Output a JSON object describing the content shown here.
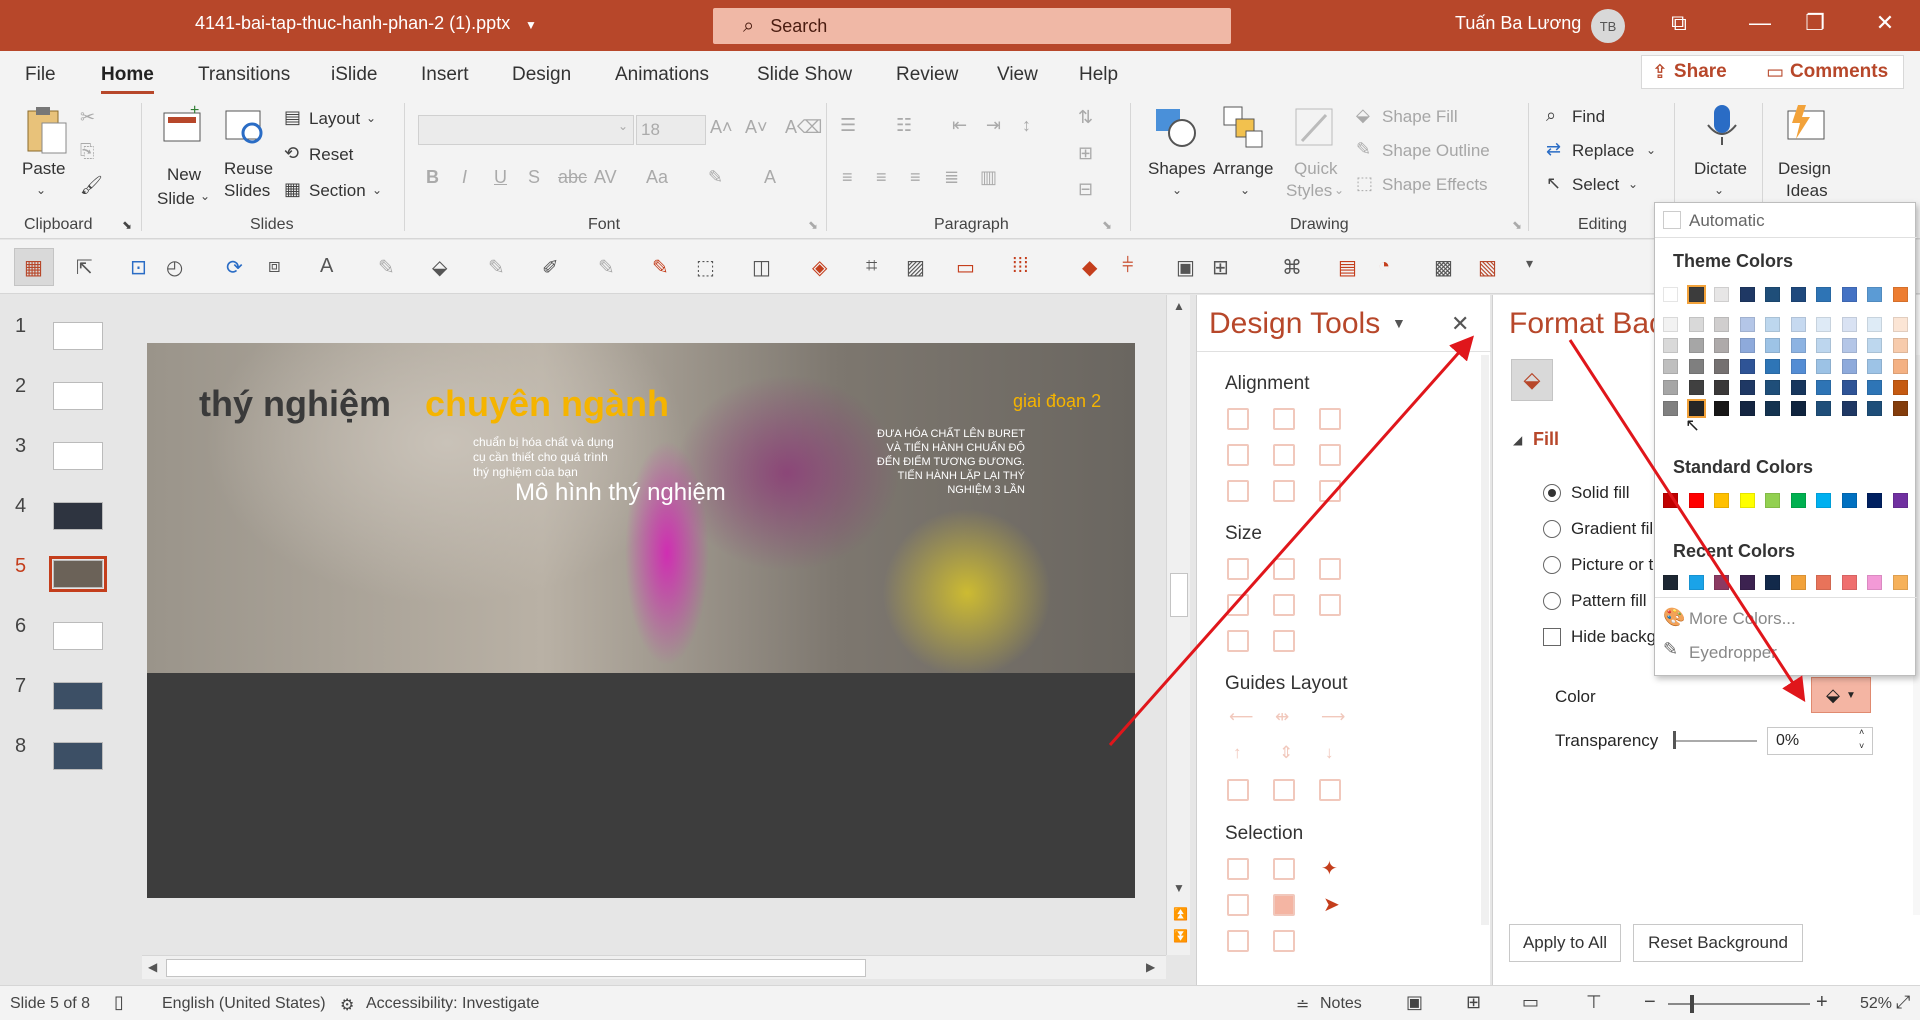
{
  "titlebar": {
    "filename": "4141-bai-tap-thuc-hanh-phan-2 (1).pptx",
    "search_placeholder": "Search",
    "user_name": "Tuấn Ba Lương",
    "user_initials": "TB"
  },
  "tabs": [
    "File",
    "Home",
    "Transitions",
    "iSlide",
    "Insert",
    "Design",
    "Animations",
    "Slide Show",
    "Review",
    "View",
    "Help"
  ],
  "share_label": "Share",
  "comments_label": "Comments",
  "ribbon": {
    "clipboard": {
      "paste": "Paste",
      "group": "Clipboard"
    },
    "slides": {
      "new_slide_1": "New",
      "new_slide_2": "Slide",
      "reuse_1": "Reuse",
      "reuse_2": "Slides",
      "layout": "Layout",
      "reset": "Reset",
      "section": "Section",
      "group": "Slides"
    },
    "font": {
      "size": "18",
      "group": "Font"
    },
    "paragraph": {
      "group": "Paragraph"
    },
    "drawing": {
      "shapes": "Shapes",
      "arrange": "Arrange",
      "quick_1": "Quick",
      "quick_2": "Styles",
      "shape_fill": "Shape Fill",
      "shape_outline": "Shape Outline",
      "shape_effects": "Shape Effects",
      "group": "Drawing"
    },
    "editing": {
      "find": "Find",
      "replace": "Replace",
      "select": "Select",
      "group": "Editing"
    },
    "voice": {
      "dictate": "Dictate"
    },
    "designer": {
      "ideas_1": "Design",
      "ideas_2": "Ideas"
    }
  },
  "thumbnails": [
    "1",
    "2",
    "3",
    "4",
    "5",
    "6",
    "7",
    "8"
  ],
  "slide": {
    "title_part1": "thý nghiệm",
    "title_part2": "chuyên ngành",
    "subtitle_1": "chuẩn bị hóa chất và dụng",
    "subtitle_2": "cụ cần thiết cho quá trình",
    "subtitle_3": "thý nghiệm của bạn",
    "model_label": "Mô hình thý nghiệm",
    "stage": "giai đoạn 2",
    "right_1": "ĐƯA HÓA CHẤT LÊN BURET",
    "right_2": "VÀ TIẾN HÀNH CHUẨN ĐỘ",
    "right_3": "ĐẾN ĐIỂM TƯƠNG ĐƯƠNG.",
    "right_4": "TIẾN HÀNH LẶP LẠI THÝ",
    "right_5": "NGHIỆM 3 LẦN"
  },
  "design_pane": {
    "title": "Design Tools",
    "sections": [
      "Alignment",
      "Size",
      "Guides Layout",
      "Selection"
    ]
  },
  "format_pane": {
    "title": "Format Background",
    "fill_label": "Fill",
    "options": [
      "Solid fill",
      "Gradient fill",
      "Picture or texture fill",
      "Pattern fill"
    ],
    "hide_label": "Hide background graphics",
    "color_label": "Color",
    "transparency_label": "Transparency",
    "transparency_value": "0%",
    "apply_all": "Apply to All",
    "reset_bg": "Reset Background"
  },
  "color_menu": {
    "automatic": "Automatic",
    "theme_title": "Theme Colors",
    "standard_title": "Standard Colors",
    "recent_title": "Recent Colors",
    "more": "More Colors...",
    "eyedropper": "Eyedropper",
    "theme_top": [
      "#ffffff",
      "#3c3c3c",
      "#e7e6e6",
      "#1f3864",
      "#1f4e79",
      "#1f497d",
      "#2e74b5",
      "#4472c4",
      "#5b9bd5",
      "#ed7d31"
    ],
    "theme_columns": [
      [
        "#f2f2f2",
        "#d9d9d9",
        "#bfbfbf",
        "#a6a6a6",
        "#808080"
      ],
      [
        "#d9d9d9",
        "#a6a6a6",
        "#7f7f7f",
        "#404040",
        "#262626"
      ],
      [
        "#d0cece",
        "#aeaaaa",
        "#757171",
        "#3a3838",
        "#171616"
      ],
      [
        "#b4c6e7",
        "#8eaadb",
        "#2f5496",
        "#1f3864",
        "#142541"
      ],
      [
        "#bdd7ee",
        "#9dc3e6",
        "#2e75b6",
        "#1f4e79",
        "#143350"
      ],
      [
        "#c6d9f0",
        "#8db3e2",
        "#548dd4",
        "#17365d",
        "#0f243e"
      ],
      [
        "#deeaf6",
        "#bdd6ee",
        "#9cc2e5",
        "#2e74b5",
        "#1f4e79"
      ],
      [
        "#d9e2f3",
        "#b4c6e7",
        "#8eaadb",
        "#2f5496",
        "#1f3864"
      ],
      [
        "#deebf6",
        "#bdd7ee",
        "#9dc3e6",
        "#2e75b6",
        "#1e4e79"
      ],
      [
        "#fbe5d5",
        "#f7cbac",
        "#f4b183",
        "#c55a11",
        "#833c0b"
      ]
    ],
    "standard": [
      "#c00000",
      "#ff0000",
      "#ffc000",
      "#ffff00",
      "#92d050",
      "#00b050",
      "#00b0f0",
      "#0070c0",
      "#002060",
      "#7030a0"
    ],
    "recent": [
      "#1d2733",
      "#1aa3e8",
      "#8b3a62",
      "#3c2250",
      "#12294a",
      "#f2a23a",
      "#e8735a",
      "#ef6f6f",
      "#f39ad7",
      "#f6b15a"
    ]
  },
  "status": {
    "slide_of": "Slide 5 of 8",
    "language": "English (United States)",
    "accessibility": "Accessibility: Investigate",
    "notes": "Notes",
    "zoom": "52%"
  }
}
